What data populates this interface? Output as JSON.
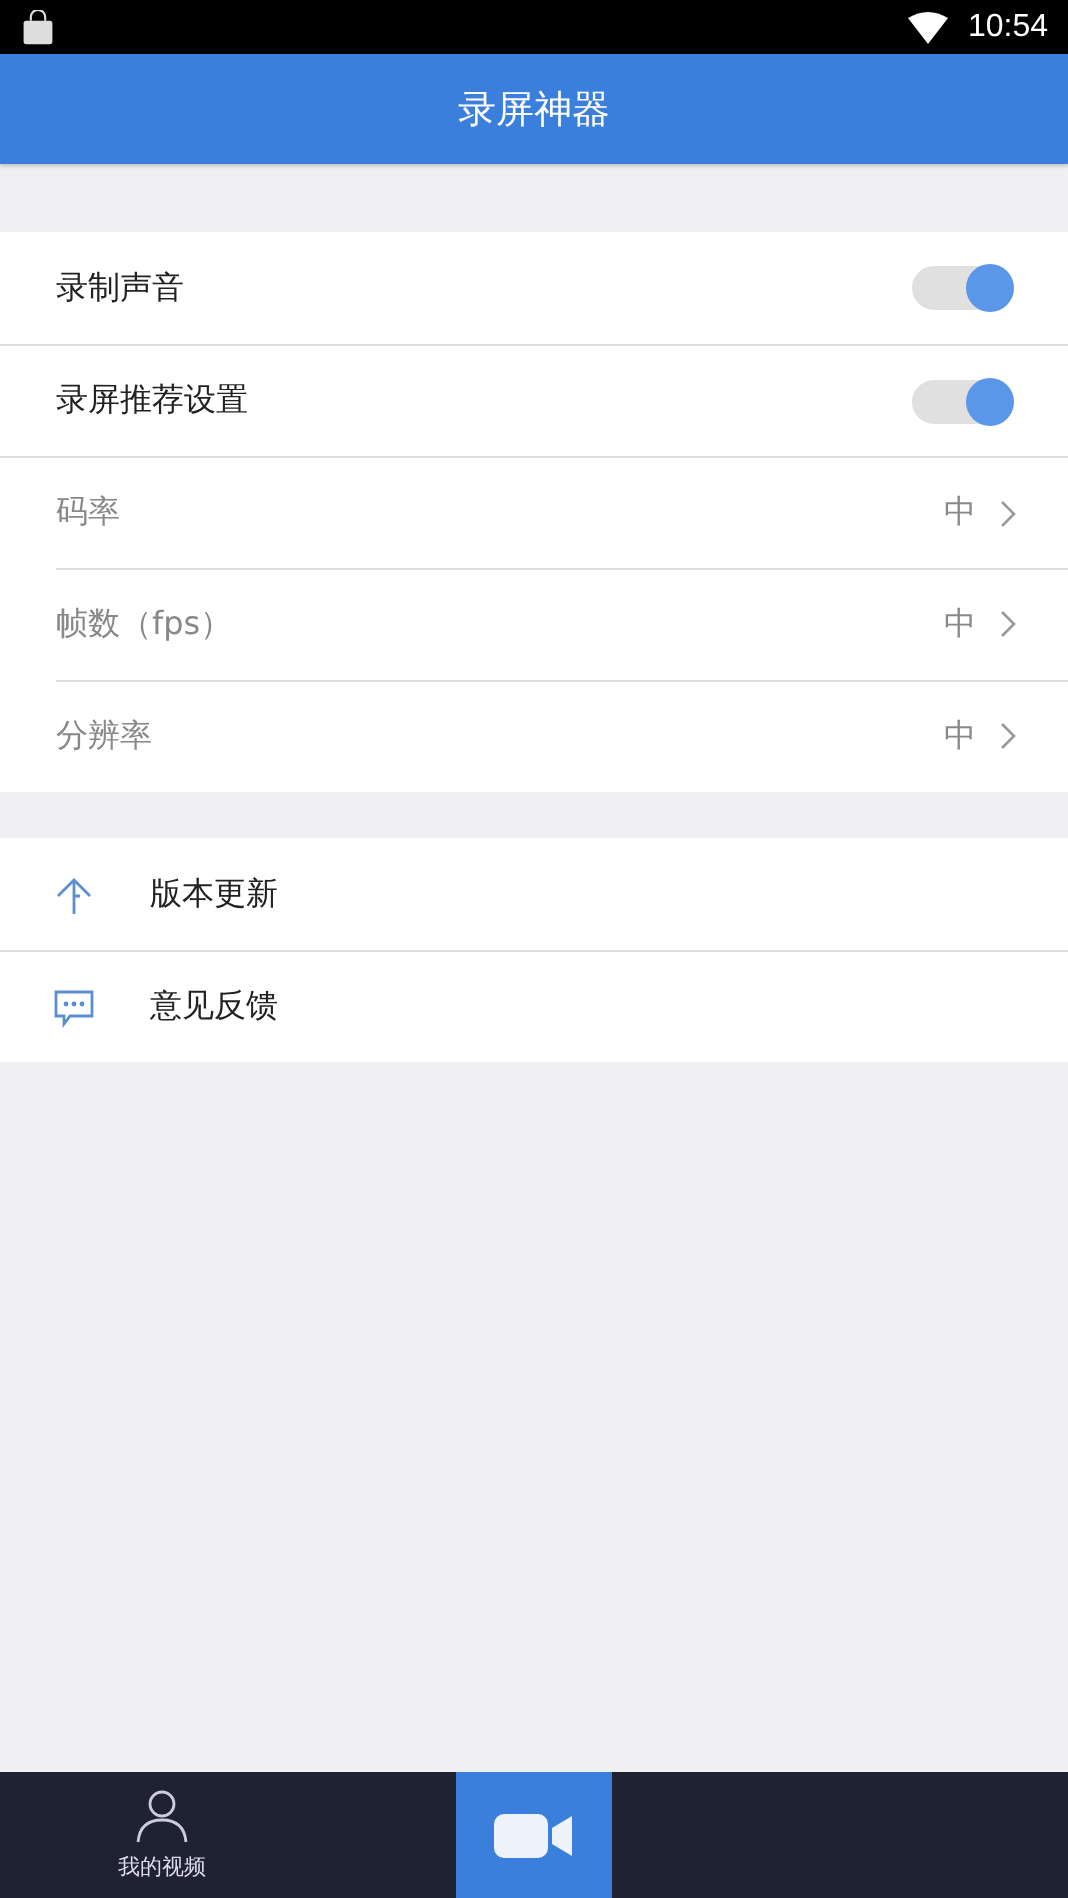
{
  "status_bar": {
    "time": "10:54"
  },
  "app_bar": {
    "title": "录屏神器"
  },
  "settings": [
    {
      "kind": "toggle",
      "label": "录制声音",
      "on": true,
      "disabled": false
    },
    {
      "kind": "toggle",
      "label": "录屏推荐设置",
      "on": true,
      "disabled": false
    },
    {
      "kind": "value",
      "label": "码率",
      "value": "中",
      "disabled": true
    },
    {
      "kind": "value",
      "label": "帧数（fps）",
      "value": "中",
      "disabled": true
    },
    {
      "kind": "value",
      "label": "分辨率",
      "value": "中",
      "disabled": true
    }
  ],
  "menu": [
    {
      "kind": "update",
      "label": "版本更新"
    },
    {
      "kind": "feedback",
      "label": "意见反馈"
    }
  ],
  "bottom_nav": [
    {
      "kind": "profile",
      "label": "我的视频"
    },
    {
      "kind": "record"
    }
  ]
}
